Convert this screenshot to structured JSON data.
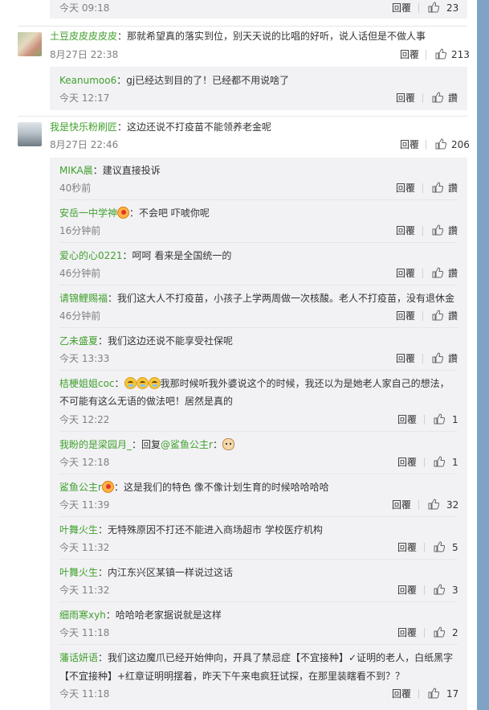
{
  "comments": [
    {
      "reply_label": "回覆"
    },
    {
      "user": "土豆皮皮皮皮皮",
      "text": "：那就希望真的落实到位，别天天说的比唱的好听，说人话但是不做人事",
      "time": "8月27日 22:38",
      "reply_label": "回覆",
      "likes": "213",
      "replies": [
        {
          "user": "Keanumoo6",
          "text": "：gj已经达到目的了！已经都不用说啥了",
          "time": "今天 12:17",
          "reply_label": "回覆",
          "like_label": "讚"
        }
      ]
    },
    {
      "user": "我是快乐粉刷匠",
      "text": "：这边还说不打疫苗不能领养老金呢",
      "time": "8月27日 22:46",
      "reply_label": "回覆",
      "likes": "206",
      "replies": [
        {
          "user": "MIKA晨",
          "text": "：建议直接投诉",
          "time": "40秒前",
          "reply_label": "回覆",
          "like_label": "讚"
        },
        {
          "user": "安岳一中学神",
          "text": "：不会吧   吓唬你呢",
          "time": "16分钟前",
          "reply_label": "回覆",
          "like_label": "讚"
        },
        {
          "user": "爱心的心0221",
          "text": "：呵呵 看来是全国统一的",
          "time": "46分钟前",
          "reply_label": "回覆",
          "like_label": "讚"
        },
        {
          "user": "请锦鲤赐福",
          "text": "：我们这大人不打疫苗，小孩子上学两周做一次核酸。老人不打疫苗，没有退休金",
          "time": "46分钟前",
          "reply_label": "回覆",
          "like_label": "讚"
        },
        {
          "user": "乙未盛夏",
          "text": "：我们这边还说不能享受社保呢",
          "time": "今天 13:33",
          "reply_label": "回覆",
          "like_label": "讚"
        },
        {
          "user": "桔梗姐姐coc",
          "text_line1": "我那时候听我外婆说这个的时候，我还以为是她老人家自己的想法，",
          "text_line2": "不可能有这么无语的做法吧！居然是真的",
          "time": "今天 12:22",
          "reply_label": "回覆",
          "likes": "1"
        },
        {
          "user": "我盼的是梁园月_",
          "text": "：回复",
          "mention": "@鲨鱼公主r",
          "time": "今天 12:18",
          "reply_label": "回覆",
          "likes": "1"
        },
        {
          "user": "鲨鱼公主r",
          "text": "：这是我们的特色 像不像计划生育的时候哈哈哈哈",
          "time": "今天 11:39",
          "reply_label": "回覆",
          "likes": "32"
        },
        {
          "user": "叶舞火生",
          "text": "：无特殊原因不打还不能进入商场超市 学校医疗机构",
          "time": "今天 11:32",
          "reply_label": "回覆",
          "likes": "5"
        },
        {
          "user": "叶舞火生",
          "text": "：内江东兴区某镇一样说过这话",
          "time": "今天 11:32",
          "reply_label": "回覆",
          "likes": "3"
        },
        {
          "user": "细雨寒xyh",
          "text": "：哈哈哈老家据说就是这样",
          "time": "今天 11:18",
          "reply_label": "回覆",
          "likes": "2"
        },
        {
          "user": "藩话妍语",
          "text_line1": "：我们这边魔爪已经开始伸向，开具了禁忌症【不宜接种】✓证明的老人，白纸黑字",
          "text_line2": "【不宜接种】+红章证明明摆着，昨天下午来电疯狂试探，在那里装瞎看不到？？",
          "time": "今天 11:18",
          "reply_label": "回覆",
          "likes": "17"
        }
      ]
    }
  ],
  "top": {
    "time": "今天 09:18",
    "reply_label": "回覆",
    "likes": "23"
  },
  "colors": {
    "username": "#41a02d",
    "time": "#808080",
    "sub_bg": "#f2f2f5",
    "rail": "#7ea3c4"
  }
}
